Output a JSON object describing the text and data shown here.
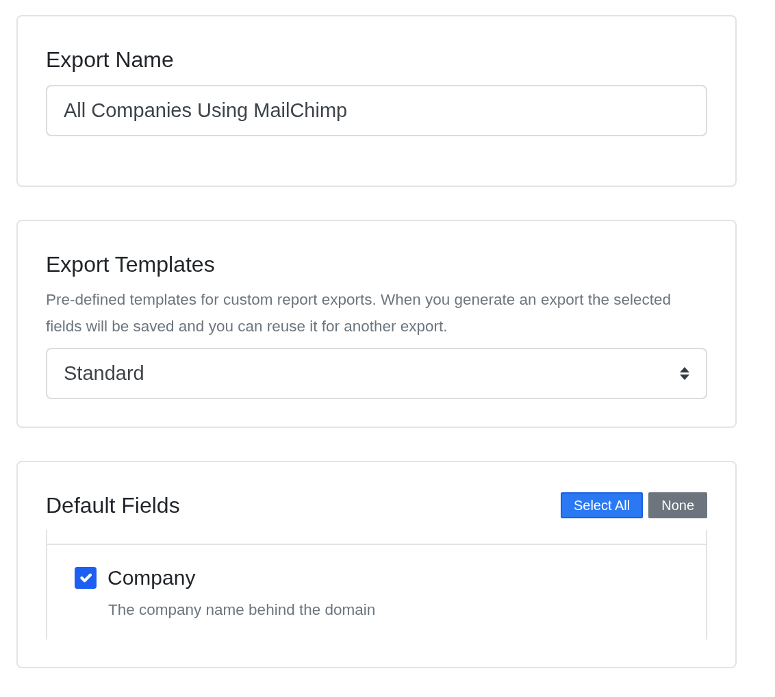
{
  "export_name": {
    "title": "Export Name",
    "value": "All Companies Using MailChimp"
  },
  "export_templates": {
    "title": "Export Templates",
    "description": "Pre-defined templates for custom report exports. When you generate an export the selected fields will be saved and you can reuse it for another export.",
    "value": "Standard"
  },
  "default_fields": {
    "title": "Default Fields",
    "buttons": [
      {
        "label": "Select All",
        "kind": "primary"
      },
      {
        "label": "None",
        "kind": "secondary"
      }
    ],
    "fields": [
      {
        "label": "Company",
        "description": "The company name behind the domain",
        "checked": true
      }
    ]
  }
}
